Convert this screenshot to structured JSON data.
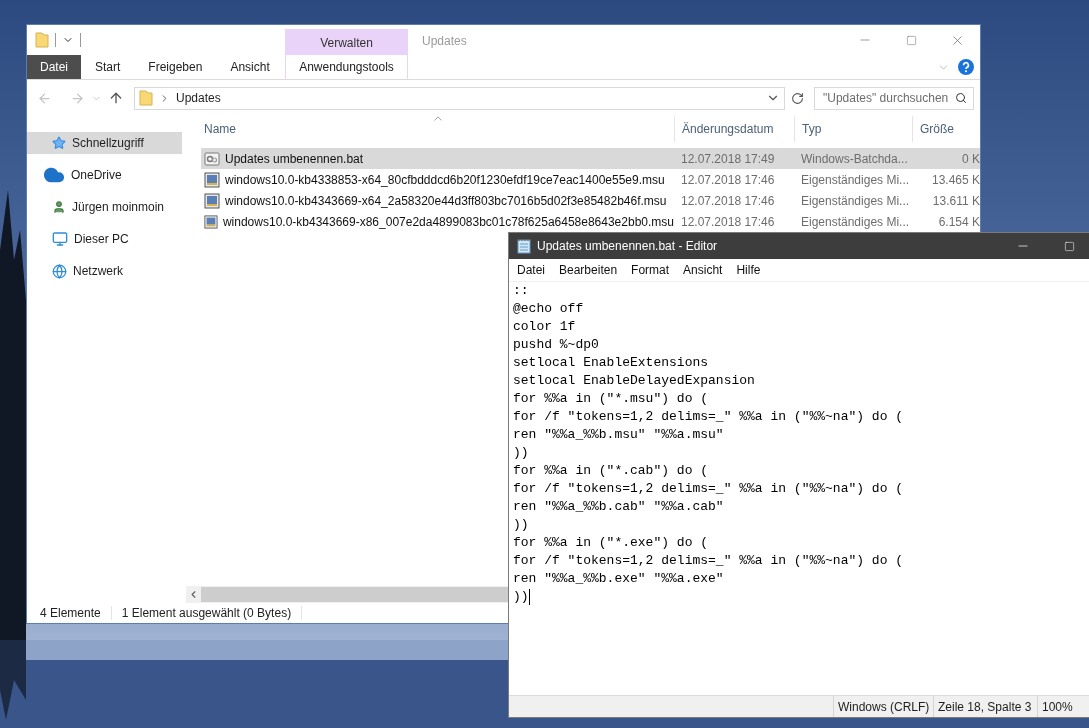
{
  "explorer": {
    "title": "Updates",
    "context_group": "Verwalten",
    "ribbon_tabs": [
      {
        "label": "Datei",
        "kind": "file"
      },
      {
        "label": "Start",
        "kind": "tab"
      },
      {
        "label": "Freigeben",
        "kind": "tab"
      },
      {
        "label": "Ansicht",
        "kind": "tab"
      },
      {
        "label": "Anwendungstools",
        "kind": "context"
      }
    ],
    "address": {
      "path": "Updates"
    },
    "search": {
      "placeholder": "\"Updates\" durchsuchen"
    },
    "sidebar": {
      "items": [
        {
          "label": "Schnellzugriff",
          "kind": "quick-access",
          "selected": true
        },
        {
          "label": "OneDrive",
          "kind": "cloud",
          "selected": false
        },
        {
          "label": "Jürgen moinmoin",
          "kind": "user",
          "selected": false
        },
        {
          "label": "Dieser PC",
          "kind": "computer",
          "selected": false
        },
        {
          "label": "Netzwerk",
          "kind": "network",
          "selected": false
        }
      ]
    },
    "table": {
      "columns": [
        {
          "label": "Name",
          "sorted": true
        },
        {
          "label": "Änderungsdatum",
          "sorted": false
        },
        {
          "label": "Typ",
          "sorted": false
        },
        {
          "label": "Größe",
          "sorted": false
        }
      ],
      "rows": [
        {
          "kind": "batch",
          "selected": true,
          "cells": [
            "Updates umbenennen.bat",
            "12.07.2018 17:49",
            "Windows-Batchda...",
            "0 K"
          ]
        },
        {
          "kind": "installer",
          "selected": false,
          "cells": [
            "windows10.0-kb4338853-x64_80cfbdddcd6b20f1230efdf19ce7eac1400e55e9.msu",
            "12.07.2018 17:46",
            "Eigenständiges Mi...",
            "13.465 K"
          ]
        },
        {
          "kind": "installer",
          "selected": false,
          "cells": [
            "windows10.0-kb4343669-x64_2a58320e44d3ff803bc7016b5d02f3e85482b46f.msu",
            "12.07.2018 17:46",
            "Eigenständiges Mi...",
            "13.611 K"
          ]
        },
        {
          "kind": "installer",
          "selected": false,
          "cells": [
            "windows10.0-kb4343669-x86_007e2da4899083bc01c78f625a6458e8643e2bb0.msu",
            "12.07.2018 17:46",
            "Eigenständiges Mi...",
            "6.154 K"
          ]
        }
      ]
    },
    "status_bar": [
      "4 Elemente",
      "1 Element ausgewählt (0 Bytes)"
    ]
  },
  "editor": {
    "title": "Updates umbenennen.bat - Editor",
    "menu": [
      "Datei",
      "Bearbeiten",
      "Format",
      "Ansicht",
      "Hilfe"
    ],
    "lines": [
      "::",
      "@echo off",
      "color 1f",
      "pushd %~dp0",
      "setlocal EnableExtensions",
      "setlocal EnableDelayedExpansion",
      "for %%a in (\"*.msu\") do (",
      "for /f \"tokens=1,2 delims=_\" %%a in (\"%%~na\") do (",
      "ren \"%%a_%%b.msu\" \"%%a.msu\"",
      "))",
      "for %%a in (\"*.cab\") do (",
      "for /f \"tokens=1,2 delims=_\" %%a in (\"%%~na\") do (",
      "ren \"%%a_%%b.cab\" \"%%a.cab\"",
      "))",
      "for %%a in (\"*.exe\") do (",
      "for /f \"tokens=1,2 delims=_\" %%a in (\"%%~na\") do (",
      "ren \"%%a_%%b.exe\" \"%%a.exe\"",
      "))"
    ],
    "status_bar": [
      "Windows (CRLF)",
      "Zeile 18, Spalte 3",
      "100%"
    ]
  }
}
